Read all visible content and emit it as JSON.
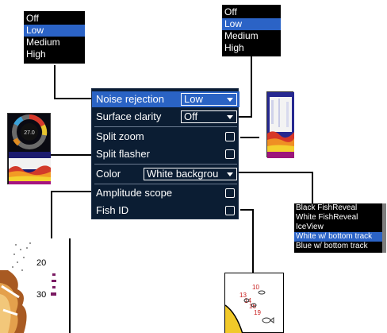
{
  "noise_popup": {
    "options": [
      {
        "label": "Off",
        "selected": false
      },
      {
        "label": "Low",
        "selected": true
      },
      {
        "label": "Medium",
        "selected": false
      },
      {
        "label": "High",
        "selected": false
      }
    ]
  },
  "clarity_popup": {
    "options": [
      {
        "label": "Off",
        "selected": false
      },
      {
        "label": "Low",
        "selected": true
      },
      {
        "label": "Medium",
        "selected": false
      },
      {
        "label": "High",
        "selected": false
      }
    ]
  },
  "menu": {
    "noise_rejection": {
      "label": "Noise rejection",
      "value": "Low"
    },
    "surface_clarity": {
      "label": "Surface clarity",
      "value": "Off"
    },
    "split_zoom": {
      "label": "Split zoom",
      "checked": false
    },
    "split_flasher": {
      "label": "Split flasher",
      "checked": false
    },
    "color": {
      "label": "Color",
      "value": "White backgrou"
    },
    "amplitude_scope": {
      "label": "Amplitude scope",
      "checked": false
    },
    "fish_id": {
      "label": "Fish ID",
      "checked": false
    }
  },
  "color_list": {
    "options": [
      {
        "label": "Black FishReveal",
        "selected": false
      },
      {
        "label": "White FishReveal",
        "selected": false
      },
      {
        "label": "IceView",
        "selected": false
      },
      {
        "label": "White w/ bottom track",
        "selected": true
      },
      {
        "label": "Blue w/ bottom track",
        "selected": false
      }
    ]
  },
  "flasher_thumb": {
    "center_value": "27.0"
  },
  "amplitude_thumb": {
    "depth_labels": [
      "20",
      "30"
    ]
  },
  "fishid_thumb": {
    "depth_labels": [
      "10",
      "13",
      "14",
      "16",
      "19"
    ]
  },
  "colors": {
    "menu_bg": "#0b1d33",
    "selection": "#2a63c4",
    "popup_bg": "#000000"
  }
}
